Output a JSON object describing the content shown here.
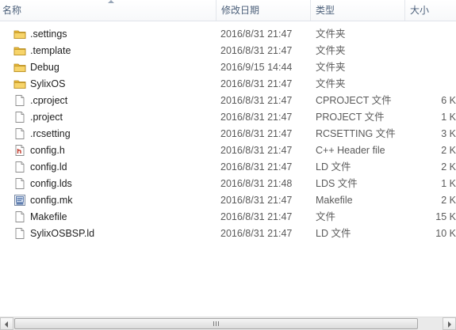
{
  "columns": {
    "name": "名称",
    "date": "修改日期",
    "type": "类型",
    "size": "大小"
  },
  "files": [
    {
      "icon": "folder-icon",
      "name": ".settings",
      "date": "2016/8/31 21:47",
      "type": "文件夹",
      "size": ""
    },
    {
      "icon": "folder-icon",
      "name": ".template",
      "date": "2016/8/31 21:47",
      "type": "文件夹",
      "size": ""
    },
    {
      "icon": "folder-icon",
      "name": "Debug",
      "date": "2016/9/15 14:44",
      "type": "文件夹",
      "size": ""
    },
    {
      "icon": "folder-icon",
      "name": "SylixOS",
      "date": "2016/8/31 21:47",
      "type": "文件夹",
      "size": ""
    },
    {
      "icon": "file-icon",
      "name": ".cproject",
      "date": "2016/8/31 21:47",
      "type": "CPROJECT 文件",
      "size": "6 K"
    },
    {
      "icon": "file-icon",
      "name": ".project",
      "date": "2016/8/31 21:47",
      "type": "PROJECT 文件",
      "size": "1 K"
    },
    {
      "icon": "file-icon",
      "name": ".rcsetting",
      "date": "2016/8/31 21:47",
      "type": "RCSETTING 文件",
      "size": "3 K"
    },
    {
      "icon": "header-file-icon",
      "name": "config.h",
      "date": "2016/8/31 21:47",
      "type": "C++ Header file",
      "size": "2 K"
    },
    {
      "icon": "file-icon",
      "name": "config.ld",
      "date": "2016/8/31 21:47",
      "type": "LD 文件",
      "size": "2 K"
    },
    {
      "icon": "file-icon",
      "name": "config.lds",
      "date": "2016/8/31 21:48",
      "type": "LDS 文件",
      "size": "1 K"
    },
    {
      "icon": "makefile-icon",
      "name": "config.mk",
      "date": "2016/8/31 21:47",
      "type": "Makefile",
      "size": "2 K"
    },
    {
      "icon": "file-icon",
      "name": "Makefile",
      "date": "2016/8/31 21:47",
      "type": "文件",
      "size": "15 K"
    },
    {
      "icon": "file-icon",
      "name": "SylixOSBSP.ld",
      "date": "2016/8/31 21:47",
      "type": "LD 文件",
      "size": "10 K"
    }
  ],
  "colors": {
    "header_text": "#4c607a",
    "folder": "#e8b83a",
    "header_file_accent": "#c0392b"
  }
}
